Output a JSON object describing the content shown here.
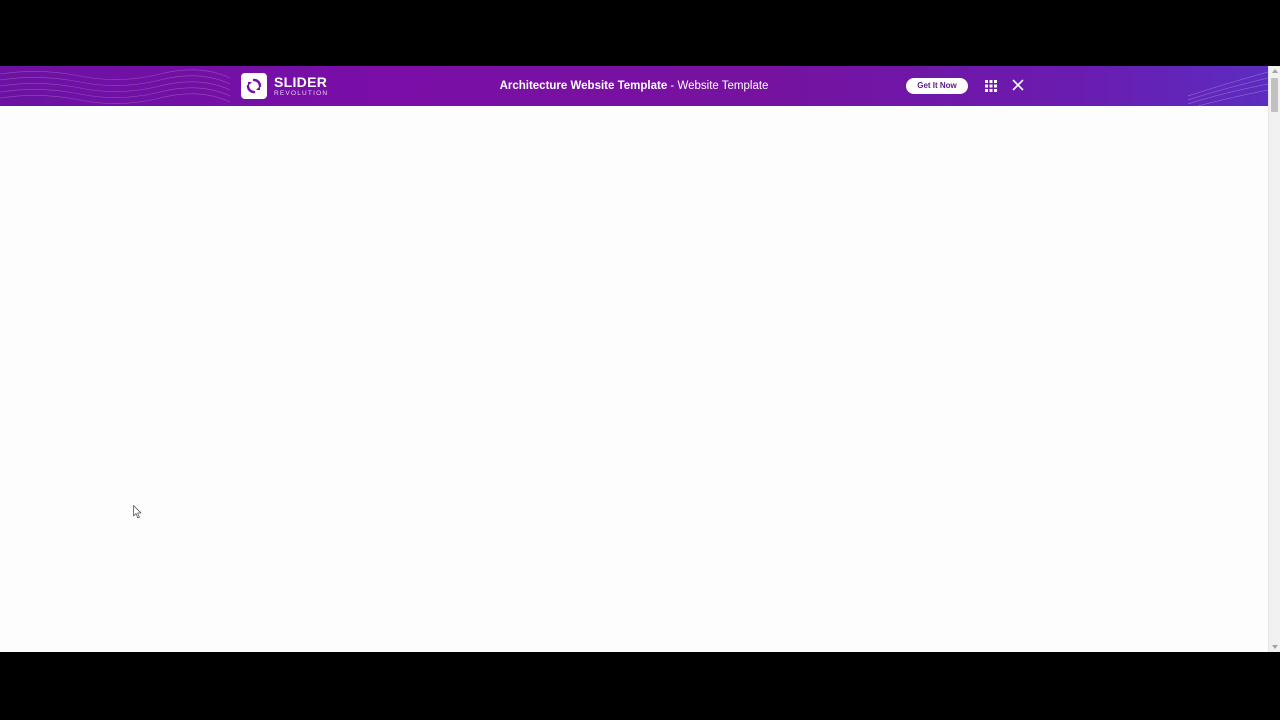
{
  "banner": {
    "brand_name": "SLIDER",
    "brand_sub": "REVOLUTION",
    "title_strong": "Architecture Website Template",
    "title_separator": " - ",
    "title_rest": "Website Template",
    "cta_label": "Get It Now"
  },
  "icons": {
    "logo": "slider-revolution-logo-icon",
    "grid": "grid-menu-icon",
    "close": "close-icon",
    "cursor": "mouse-pointer-icon"
  },
  "colors": {
    "banner_primary": "#76129f",
    "banner_accent": "#5d2cc0",
    "button_text": "#5a1a8a",
    "page_background": "#fdfdfd"
  }
}
